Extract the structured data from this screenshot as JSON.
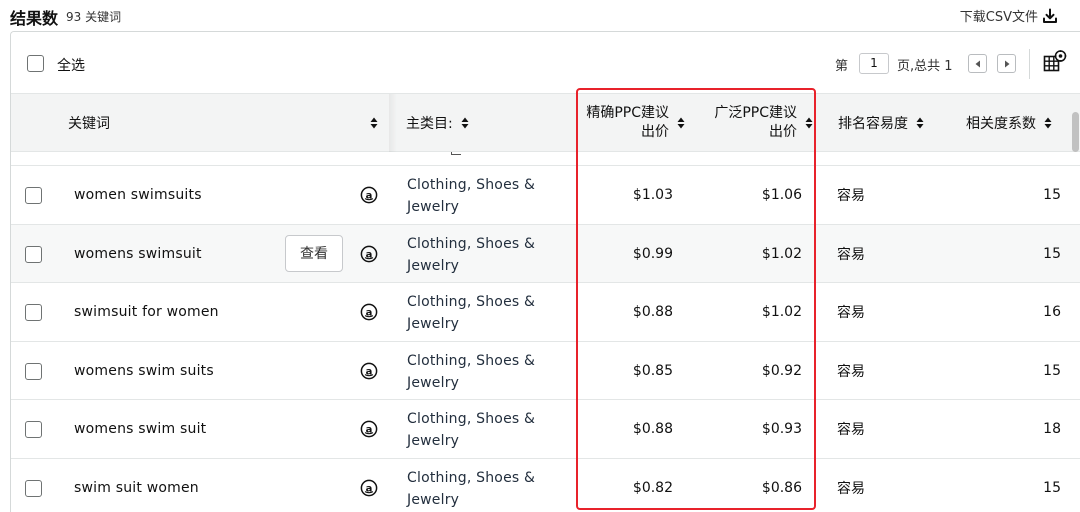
{
  "header": {
    "title": "结果数",
    "count_text": "93 关键词",
    "csv_label": "下载CSV文件"
  },
  "toolbar": {
    "select_all_label": "全选",
    "page_prefix": "第",
    "page_value": "1",
    "page_suffix": "页,总共 1"
  },
  "columns": {
    "keyword": "关键词",
    "category": "主类目:",
    "exact_ppc_line1": "精确PPC建议",
    "exact_ppc_line2": "出价",
    "broad_ppc_line1": "广泛PPC建议",
    "broad_ppc_line2": "出价",
    "difficulty": "排名容易度",
    "relevance": "相关度系数"
  },
  "view_button_label": "查看",
  "rows": [
    {
      "keyword": "women swimsuits",
      "category_line1": "Clothing, Shoes &",
      "category_line2": "Jewelry",
      "exact_ppc": "$1.03",
      "broad_ppc": "$1.06",
      "difficulty": "容易",
      "relevance": "15"
    },
    {
      "keyword": "womens swimsuit",
      "category_line1": "Clothing, Shoes &",
      "category_line2": "Jewelry",
      "exact_ppc": "$0.99",
      "broad_ppc": "$1.02",
      "difficulty": "容易",
      "relevance": "15"
    },
    {
      "keyword": "swimsuit for women",
      "category_line1": "Clothing, Shoes &",
      "category_line2": "Jewelry",
      "exact_ppc": "$0.88",
      "broad_ppc": "$1.02",
      "difficulty": "容易",
      "relevance": "16"
    },
    {
      "keyword": "womens swim suits",
      "category_line1": "Clothing, Shoes &",
      "category_line2": "Jewelry",
      "exact_ppc": "$0.85",
      "broad_ppc": "$0.92",
      "difficulty": "容易",
      "relevance": "15"
    },
    {
      "keyword": "womens swim suit",
      "category_line1": "Clothing, Shoes &",
      "category_line2": "Jewelry",
      "exact_ppc": "$0.88",
      "broad_ppc": "$0.93",
      "difficulty": "容易",
      "relevance": "18"
    },
    {
      "keyword": "swim suit women",
      "category_line1": "Clothing, Shoes &",
      "category_line2": "Jewelry",
      "exact_ppc": "$0.82",
      "broad_ppc": "$0.86",
      "difficulty": "容易",
      "relevance": "15"
    }
  ],
  "icons": {
    "download": "download-icon",
    "settings": "table-settings-icon",
    "amazon": "amazon-icon",
    "sort": "sort-icon"
  },
  "colors": {
    "highlight": "#e8222b",
    "header_bg": "#f3f4f4",
    "border": "#d5d9d9"
  }
}
